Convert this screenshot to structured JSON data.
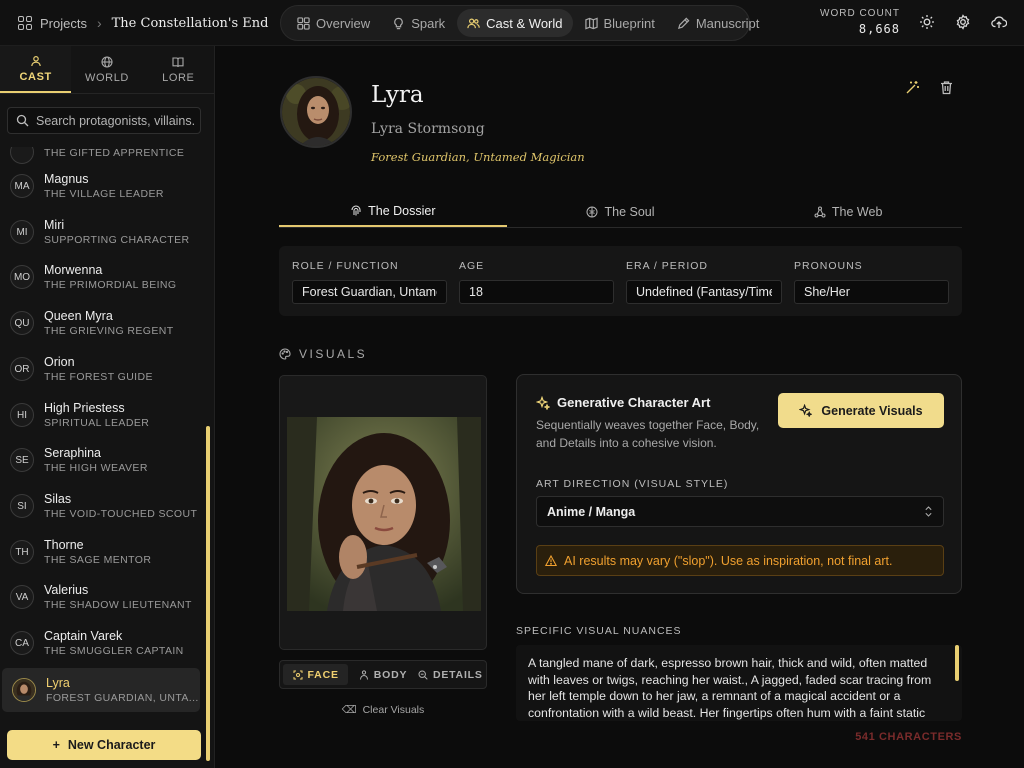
{
  "topbar": {
    "projects_label": "Projects",
    "project_name": "The Constellation's End",
    "nav": [
      {
        "label": "Overview",
        "icon": "grid-icon"
      },
      {
        "label": "Spark",
        "icon": "bulb-icon"
      },
      {
        "label": "Cast & World",
        "icon": "users-icon",
        "active": true
      },
      {
        "label": "Blueprint",
        "icon": "map-icon"
      },
      {
        "label": "Manuscript",
        "icon": "pen-icon"
      }
    ],
    "word_count_label": "WORD COUNT",
    "word_count_value": "8,668"
  },
  "sidebar": {
    "tabs": [
      {
        "label": "CAST",
        "icon": "user-icon",
        "active": true
      },
      {
        "label": "WORLD",
        "icon": "globe-icon"
      },
      {
        "label": "LORE",
        "icon": "book-icon"
      }
    ],
    "search_placeholder": "Search protagonists, villains...",
    "partial_role": "THE GIFTED APPRENTICE",
    "characters": [
      {
        "initials": "MA",
        "name": "Magnus",
        "role": "THE VILLAGE LEADER"
      },
      {
        "initials": "MI",
        "name": "Miri",
        "role": "SUPPORTING CHARACTER"
      },
      {
        "initials": "MO",
        "name": "Morwenna",
        "role": "THE PRIMORDIAL BEING"
      },
      {
        "initials": "QU",
        "name": "Queen Myra",
        "role": "THE GRIEVING REGENT"
      },
      {
        "initials": "OR",
        "name": "Orion",
        "role": "THE FOREST GUIDE"
      },
      {
        "initials": "HI",
        "name": "High Priestess",
        "role": "SPIRITUAL LEADER"
      },
      {
        "initials": "SE",
        "name": "Seraphina",
        "role": "THE HIGH WEAVER"
      },
      {
        "initials": "SI",
        "name": "Silas",
        "role": "THE VOID-TOUCHED SCOUT"
      },
      {
        "initials": "TH",
        "name": "Thorne",
        "role": "THE SAGE MENTOR"
      },
      {
        "initials": "VA",
        "name": "Valerius",
        "role": "THE SHADOW LIEUTENANT"
      },
      {
        "initials": "CA",
        "name": "Captain Varek",
        "role": "THE SMUGGLER CAPTAIN"
      },
      {
        "initials": "",
        "name": "Lyra",
        "role": "FOREST GUARDIAN, UNTA...",
        "active": true
      }
    ],
    "new_character_label": "New Character"
  },
  "character": {
    "name": "Lyra",
    "full_name": "Lyra Stormsong",
    "tagline": "Forest Guardian, Untamed Magician"
  },
  "subtabs": [
    {
      "label": "The Dossier",
      "icon": "fingerprint-icon",
      "active": true
    },
    {
      "label": "The Soul",
      "icon": "soul-icon"
    },
    {
      "label": "The Web",
      "icon": "network-icon"
    }
  ],
  "fields": {
    "role_label": "ROLE / FUNCTION",
    "role_value": "Forest Guardian, Untamed Magician",
    "age_label": "AGE",
    "age_value": "18",
    "era_label": "ERA / PERIOD",
    "era_value": "Undefined (Fantasy/Timeless)",
    "pronouns_label": "PRONOUNS",
    "pronouns_value": "She/Her"
  },
  "visuals": {
    "heading": "VISUALS",
    "segments": [
      {
        "label": "FACE",
        "icon": "focus-icon",
        "active": true
      },
      {
        "label": "BODY",
        "icon": "person-icon"
      },
      {
        "label": "DETAILS",
        "icon": "zoom-icon"
      }
    ],
    "clear_label": "Clear Visuals",
    "gen_title": "Generative Character Art",
    "gen_desc": "Sequentially weaves together Face, Body, and Details into a cohesive vision.",
    "gen_button": "Generate Visuals",
    "art_direction_label": "ART DIRECTION (VISUAL STYLE)",
    "art_direction_value": "Anime / Manga",
    "warning": "AI results may vary (\"slop\"). Use as inspiration, not final art.",
    "nuances_label": "SPECIFIC VISUAL NUANCES",
    "nuances_text": "A tangled mane of dark, espresso brown hair, thick and wild, often matted with leaves or twigs, reaching her waist., A jagged, faded scar tracing from her left temple down to her jaw, a remnant of a magical accident or a confrontation with a wild beast. Her fingertips often hum with a faint static",
    "char_count": "541 CHARACTERS"
  },
  "colors": {
    "accent": "#f1dc8c",
    "warning": "#f0a02f",
    "count": "#7a2b2b"
  }
}
